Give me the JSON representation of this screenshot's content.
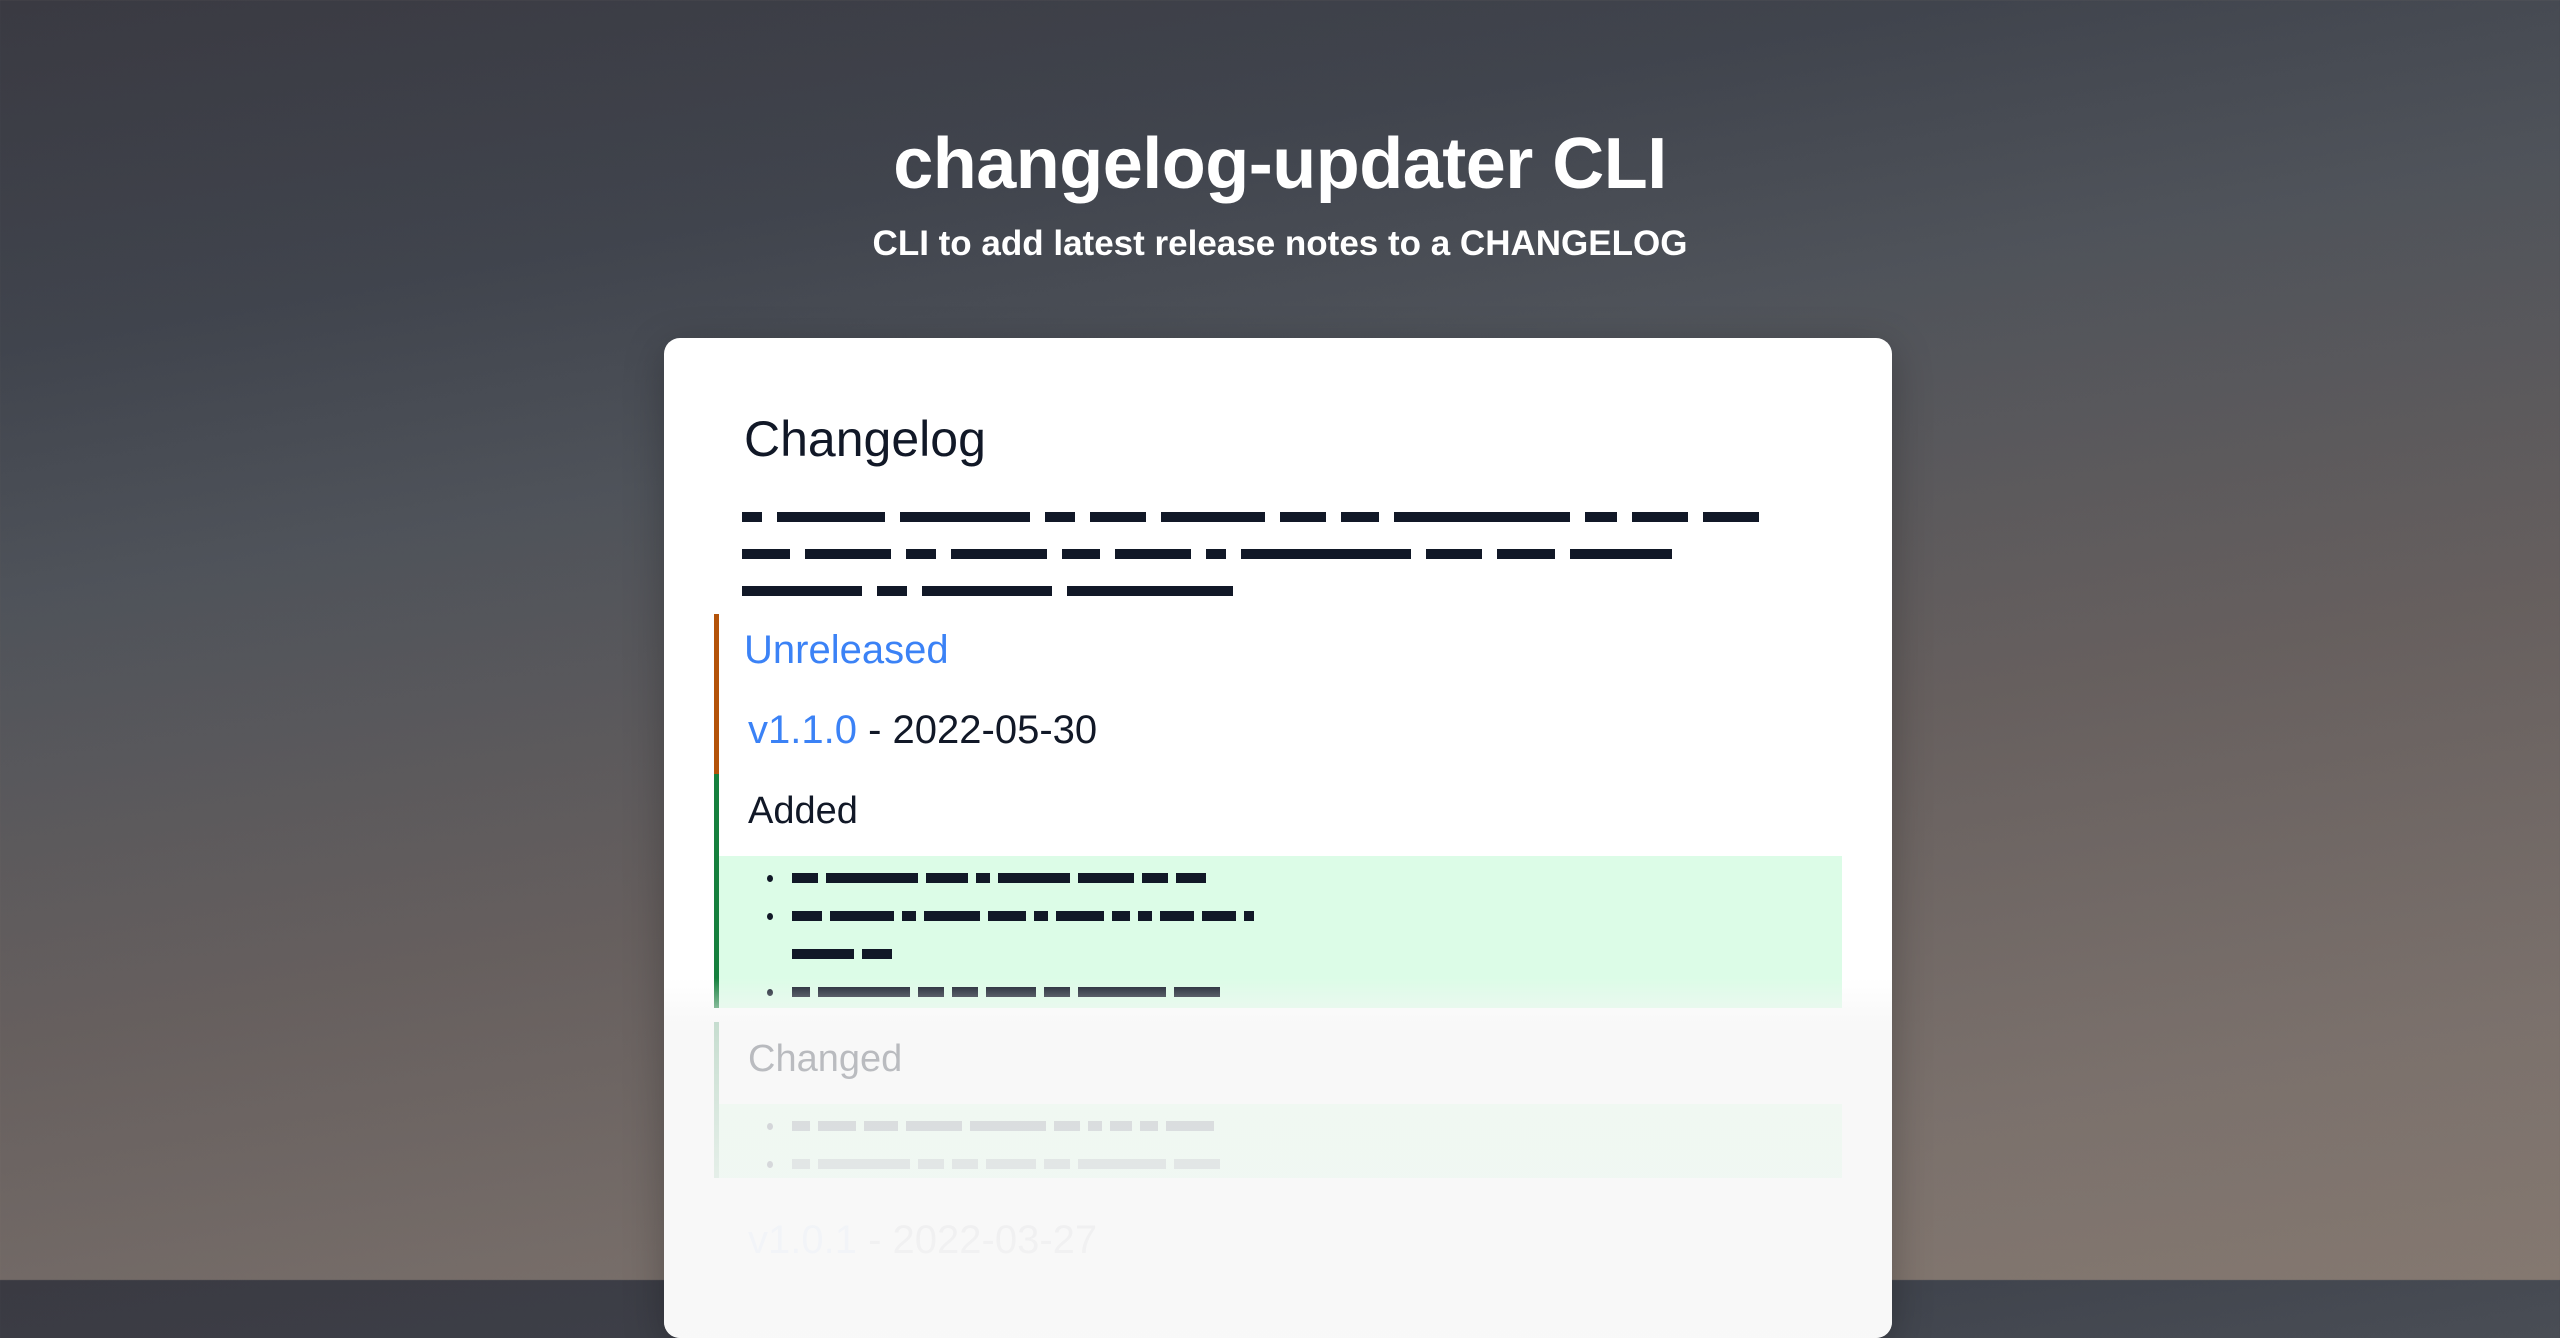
{
  "hero": {
    "title": "changelog-updater CLI",
    "subtitle": "CLI to add latest release notes to a CHANGELOG"
  },
  "card": {
    "heading": "Changelog",
    "intro_redacted": true,
    "unreleased_label": "Unreleased",
    "release": {
      "version": "v1.1.0",
      "separator": " - ",
      "date": "2022-05-30"
    },
    "sections": [
      {
        "title": "Added",
        "item_count": 3,
        "items_redacted": true
      },
      {
        "title": "Changed",
        "item_count": 2,
        "items_redacted": true
      }
    ],
    "next_release": {
      "version": "v1.0.1",
      "separator": " - ",
      "date": "2022-03-27"
    }
  },
  "colors": {
    "link": "#3b82f6",
    "text": "#111827",
    "unreleased_accent": "#b45309",
    "added_accent": "#15803d",
    "added_bg": "#dcfce7"
  }
}
